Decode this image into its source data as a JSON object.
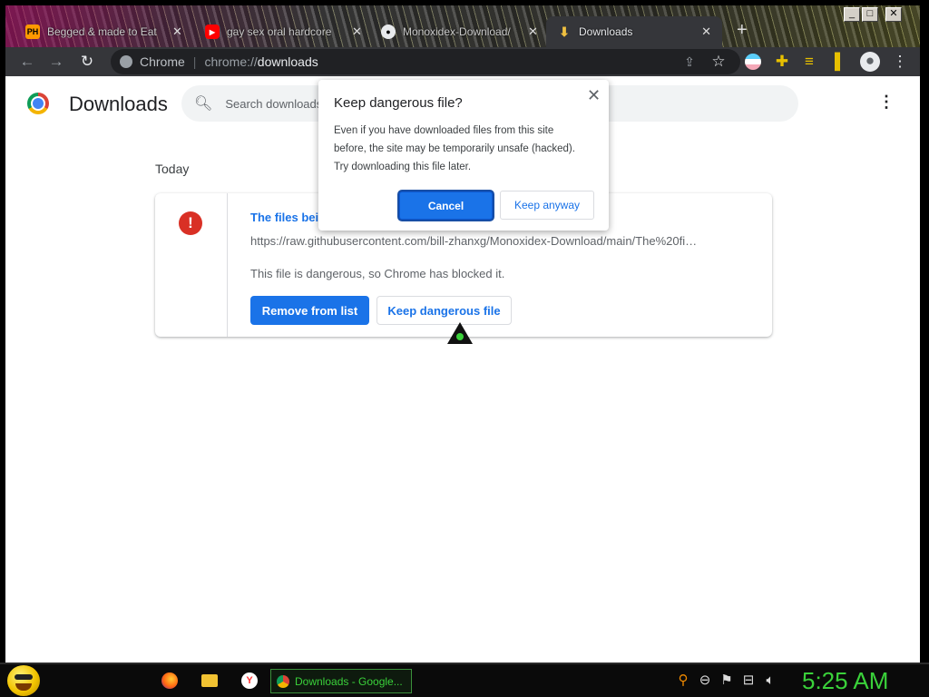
{
  "browser": {
    "tabs": [
      {
        "label": "Begged & made to Eat",
        "favicon": "PH"
      },
      {
        "label": "gay sex oral hardcore",
        "favicon": "▶"
      },
      {
        "label": "Monoxidex-Download/",
        "favicon": "●"
      },
      {
        "label": "Downloads",
        "favicon": "⬇"
      }
    ],
    "new_tab_icon": "+",
    "window_buttons": {
      "minimize": "_",
      "maximize": "□",
      "close": "✕"
    },
    "omnibox": {
      "site_chip": "Chrome",
      "scheme": "chrome://",
      "host": "downloads"
    }
  },
  "page": {
    "title": "Downloads",
    "search_placeholder": "Search downloads",
    "section": "Today",
    "download": {
      "file_name": "The files bein",
      "url": "https://raw.githubusercontent.com/bill-zhanxg/Monoxidex-Download/main/The%20fi…",
      "status": "This file is dangerous, so Chrome has blocked it.",
      "remove_label": "Remove from list",
      "keep_label": "Keep dangerous file"
    }
  },
  "dialog": {
    "title": "Keep dangerous file?",
    "body_lines": [
      "Even if you have downloaded files from this site",
      "before, the site may be temporarily unsafe (hacked).",
      "Try downloading this file later."
    ],
    "cancel_label": "Cancel",
    "keep_label": "Keep anyway"
  },
  "taskbar": {
    "active_task": "Downloads - Google...",
    "clock": "5:25 AM"
  },
  "colors": {
    "accent": "#1a73e8",
    "danger": "#d93025",
    "clock_green": "#3ad13a"
  }
}
